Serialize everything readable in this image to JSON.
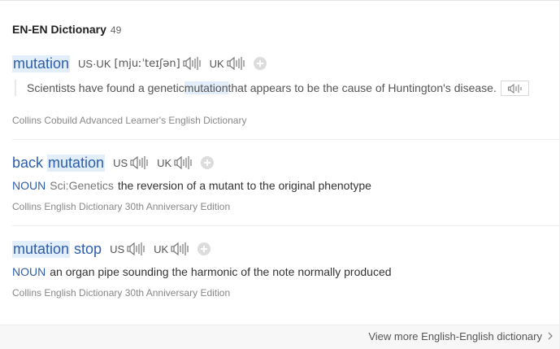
{
  "header": {
    "title": "EN-EN Dictionary",
    "count": "49"
  },
  "entries": [
    {
      "word_parts": [
        {
          "text": "mutation",
          "highlight": true
        }
      ],
      "pron_label_us": "US·UK",
      "phonetic": "[mjuːˈteɪʃən]",
      "pron_label_uk": "UK",
      "example": {
        "before": "Scientists have found a genetic ",
        "highlight": "mutation",
        "after": " that appears to be the cause of Huntington's disease."
      },
      "source": "Collins Cobuild Advanced Learner's English Dictionary"
    },
    {
      "word_parts": [
        {
          "text": "back",
          "highlight": false
        },
        {
          "text": "mutation",
          "highlight": true
        }
      ],
      "pron_label_us": "US",
      "pron_label_uk": "UK",
      "pos": "NOUN",
      "domain": "Sci:Genetics",
      "definition": "the reversion of a mutant to the original phenotype",
      "source": "Collins English Dictionary 30th Anniversary Edition"
    },
    {
      "word_parts": [
        {
          "text": "mutation",
          "highlight": true
        },
        {
          "text": "stop",
          "highlight": false
        }
      ],
      "pron_label_us": "US",
      "pron_label_uk": "UK",
      "pos": "NOUN",
      "definition": "an organ pipe sounding the harmonic of the note normally produced",
      "source": "Collins English Dictionary 30th Anniversary Edition"
    }
  ],
  "footer": {
    "more_label": "View more English-English dictionary"
  },
  "icons": {
    "speaker": "speaker-icon",
    "add": "plus-icon",
    "more": "chevron-right-icon"
  },
  "colors": {
    "link": "#2e5eaa",
    "highlight": "#e3eefb",
    "muted": "#888888"
  }
}
